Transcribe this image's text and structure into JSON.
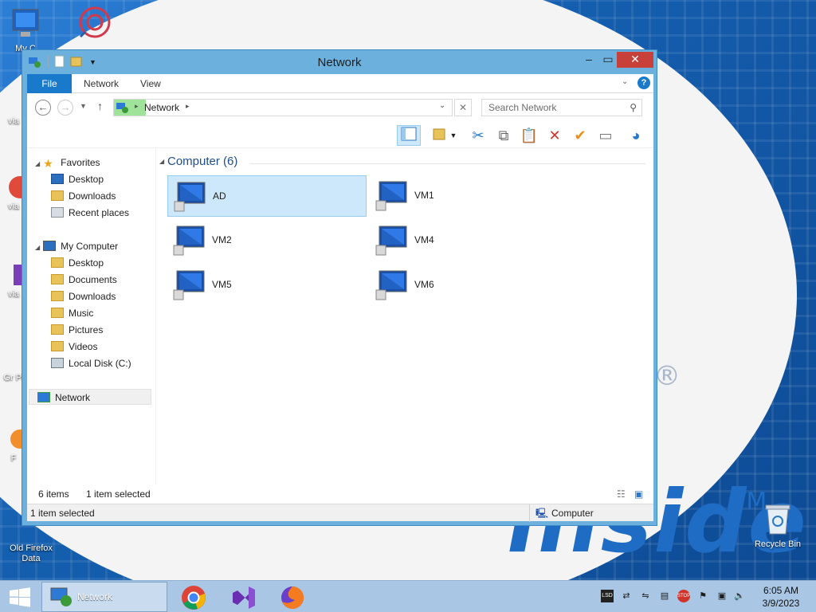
{
  "window": {
    "title": "Network"
  },
  "ribbon": {
    "file": "File",
    "network": "Network",
    "view": "View"
  },
  "address": {
    "location": "Network",
    "search_placeholder": "Search Network"
  },
  "nav": {
    "favorites": "Favorites",
    "fav_items": [
      "Desktop",
      "Downloads",
      "Recent places"
    ],
    "my_computer": "My Computer",
    "pc_items": [
      "Desktop",
      "Documents",
      "Downloads",
      "Music",
      "Pictures",
      "Videos",
      "Local Disk (C:)"
    ],
    "network": "Network"
  },
  "content": {
    "group_label": "Computer (6)",
    "computers": [
      "AD",
      "VM1",
      "VM2",
      "VM4",
      "VM5",
      "VM6"
    ],
    "selected": "AD"
  },
  "status": {
    "items": "6 items",
    "selected": "1 item selected",
    "footer_selected": "1 item selected",
    "footer_type": "Computer"
  },
  "desktop": {
    "icons": [
      "My C",
      "via",
      "via",
      "via",
      "Gr Pl",
      "F",
      "Old Firefox Data",
      "Recycle Bin"
    ]
  },
  "wallpaper": {
    "brand_text": "inside",
    "tm": "TM",
    "reg": "®"
  },
  "taskbar": {
    "active_window": "Network",
    "time": "6:05 AM",
    "date": "3/9/2023"
  },
  "colors": {
    "accent": "#1979ca",
    "selection": "#cde8fb",
    "close": "#c7403a",
    "taskbar": "#a9c6e4"
  }
}
